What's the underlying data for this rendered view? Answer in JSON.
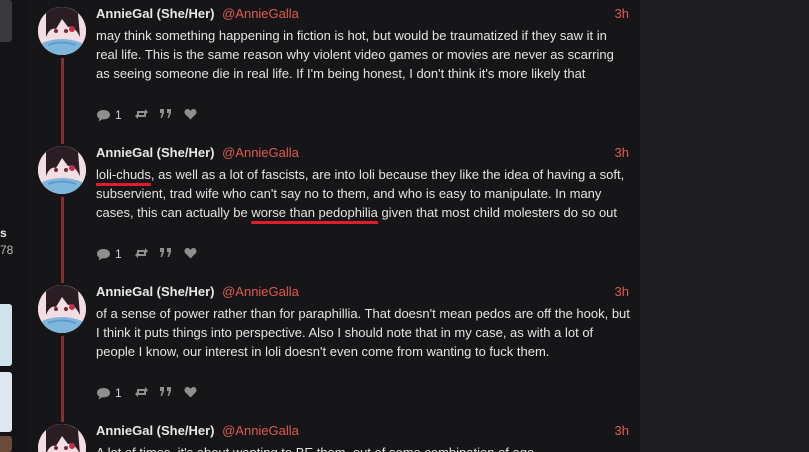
{
  "posts": [
    {
      "display_name": "AnnieGal (She/Her)",
      "handle": "@AnnieGalla",
      "time": "3h",
      "text": "may think something happening in fiction is hot, but would be traumatized if they saw it in real life. This is the same reason why violent video games or movies are never as scarring as seeing someone die in real life. If I'm being honest, I don't think it's more likely that",
      "replies": "1"
    },
    {
      "display_name": "AnnieGal (She/Her)",
      "handle": "@AnnieGalla",
      "time": "3h",
      "text_parts": [
        "loli-chuds",
        ", as well as a lot of fascists, are into loli because they like the idea of having a soft, subservient, trad wife who can't say no to them, and who is easy to manipulate. In many cases, this can actually be ",
        "worse than pedophilia",
        " given that most child molesters do so out"
      ],
      "replies": "1"
    },
    {
      "display_name": "AnnieGal (She/Her)",
      "handle": "@AnnieGalla",
      "time": "3h",
      "text": "of a sense of power rather than for paraphillia. That doesn't mean pedos are off the hook, but I think it puts things into perspective. Also I should note that in my case, as with a lot of people I know, our interest in loli doesn't even come from wanting to fuck them.",
      "replies": "1"
    },
    {
      "display_name": "AnnieGal (She/Her)",
      "handle": "@AnnieGalla",
      "time": "3h",
      "text": "A lot of times, it's about wanting to BE them, out of some combination of ago"
    }
  ],
  "left_strip": {
    "label": "s",
    "count": "78"
  },
  "colors": {
    "accent": "#e05a4f",
    "thread": "#8a2f2f",
    "underline": "#e11d2c"
  },
  "icons": [
    "reply-icon",
    "repost-icon",
    "quote-icon",
    "heart-icon"
  ]
}
